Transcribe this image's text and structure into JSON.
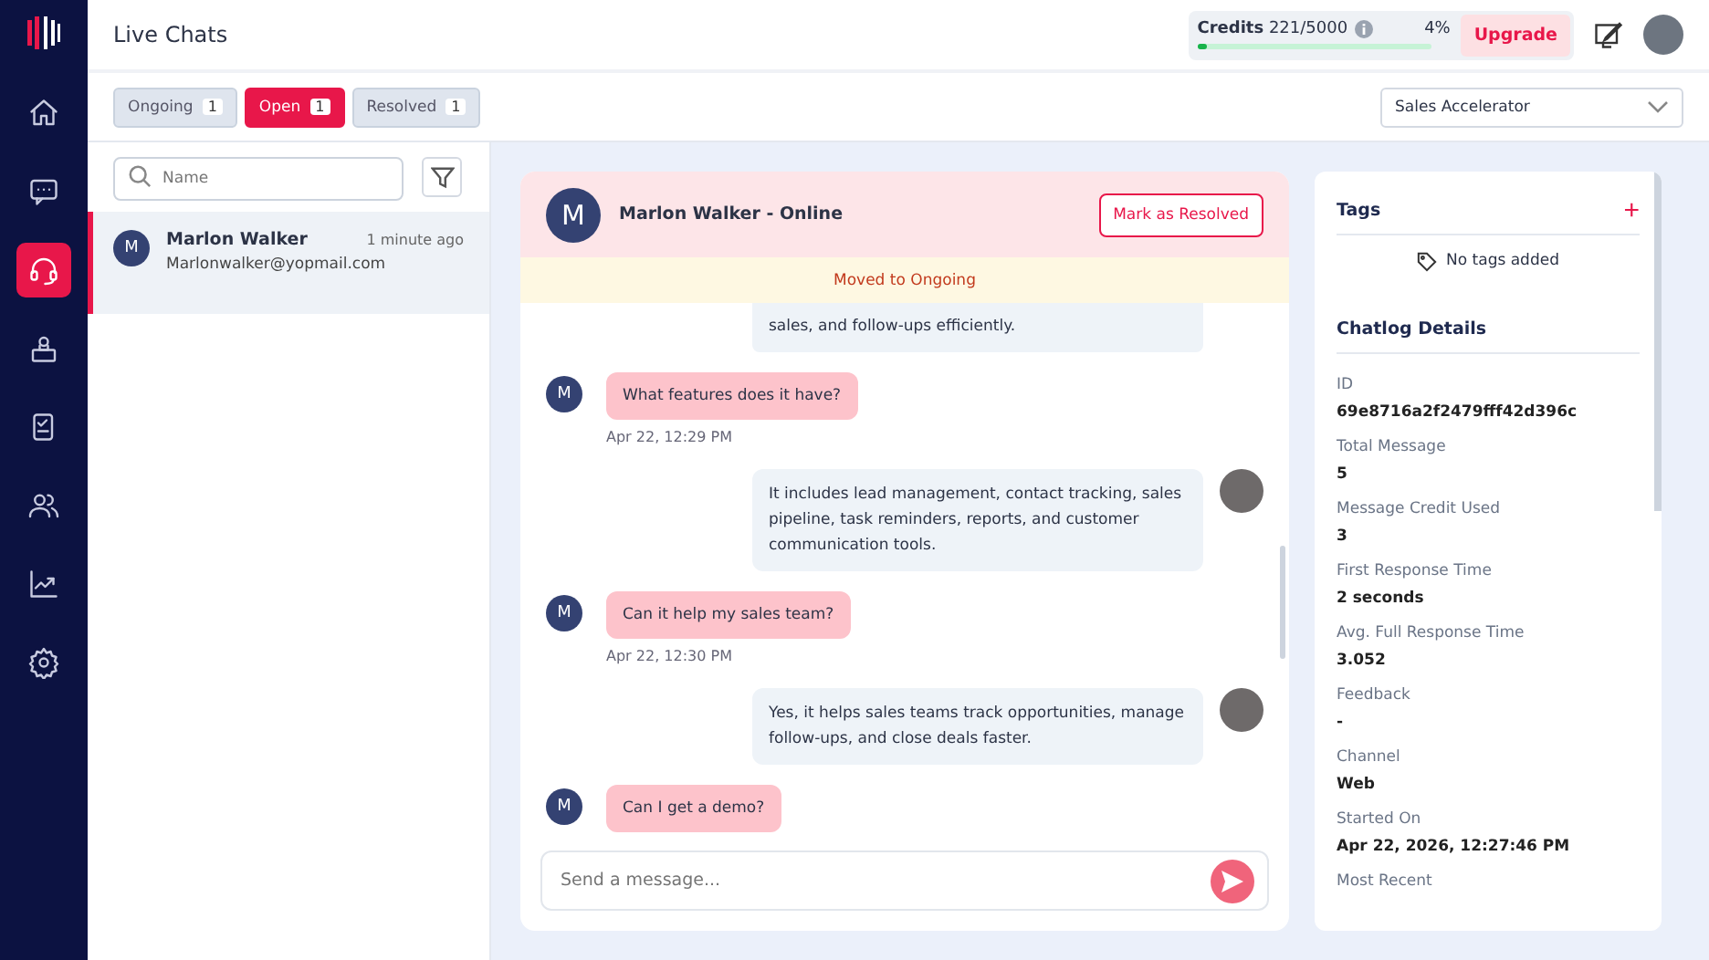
{
  "sidebar": {
    "items": [
      {
        "selected": false
      },
      {
        "selected": false
      },
      {
        "selected": true
      },
      {
        "selected": false
      },
      {
        "selected": false
      },
      {
        "selected": false
      },
      {
        "selected": false
      },
      {
        "selected": false
      }
    ]
  },
  "header": {
    "title": "Live Chats",
    "credits": {
      "label": "Credits",
      "value": "221/5000",
      "percent": "4%",
      "level": 0.044
    },
    "upgrade": "Upgrade"
  },
  "tabs": [
    {
      "label": "Ongoing",
      "count": "1",
      "selected": false
    },
    {
      "label": "Open",
      "count": "1",
      "selected": true
    },
    {
      "label": "Resolved",
      "count": "1",
      "selected": false
    }
  ],
  "bot_select": {
    "value": "Sales Accelerator"
  },
  "search": {
    "placeholder": "Name"
  },
  "chat_list": [
    {
      "initial": "M",
      "name": "Marlon Walker",
      "time": "1 minute ago",
      "email": "Marlonwalker@yopmail.com",
      "selected": true
    }
  ],
  "chat": {
    "initial": "M",
    "title": "Marlon Walker - Online",
    "resolve_button": "Mark as Resolved",
    "banner": "Moved to Ongoing",
    "messages": [
      {
        "kind": "agent",
        "text": "sales, and follow-ups efficiently."
      },
      {
        "kind": "customer",
        "initial": "M",
        "text": "What features does it have?",
        "time": "Apr 22, 12:29 PM"
      },
      {
        "kind": "agent",
        "text": "It includes lead management, contact tracking, sales pipeline, task reminders, reports, and customer communication tools."
      },
      {
        "kind": "customer",
        "initial": "M",
        "text": "Can it help my sales team?",
        "time": "Apr 22, 12:30 PM"
      },
      {
        "kind": "agent",
        "text": "Yes, it helps sales teams track opportunities, manage follow-ups, and close deals faster."
      },
      {
        "kind": "customer",
        "initial": "M",
        "text": "Can I get a demo?"
      }
    ],
    "input": {
      "placeholder": "Send a message..."
    }
  },
  "details": {
    "tags_title": "Tags",
    "tags_add": "+",
    "no_tags": "No tags added",
    "chatlog_title": "Chatlog Details",
    "fields": [
      {
        "label": "ID",
        "value": "69e8716a2f2479fff42d396c"
      },
      {
        "label": "Total Message",
        "value": "5"
      },
      {
        "label": "Message Credit Used",
        "value": "3"
      },
      {
        "label": "First Response Time",
        "value": "2 seconds"
      },
      {
        "label": "Avg. Full Response Time",
        "value": "3.052"
      },
      {
        "label": "Feedback",
        "value": "-"
      },
      {
        "label": "Channel",
        "value": "Web"
      },
      {
        "label": "Started On",
        "value": "Apr 22, 2026, 12:27:46 PM"
      },
      {
        "label": "Most Recent"
      }
    ]
  }
}
